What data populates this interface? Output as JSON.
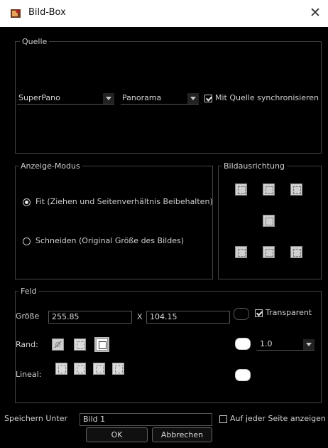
{
  "window": {
    "title": "Bild-Box",
    "close_glyph": "✕"
  },
  "quelle": {
    "legend": "Quelle",
    "source_select": "SuperPano",
    "type_select": "Panorama",
    "sync_label": "Mit Quelle synchronisieren",
    "sync_checked": true
  },
  "anzeige": {
    "legend": "Anzeige-Modus",
    "options": [
      {
        "label": "Fit (Ziehen und Seitenverhältnis Beibehalten)",
        "selected": true
      },
      {
        "label": "Schneiden (Original Größe des Bildes)",
        "selected": false
      }
    ]
  },
  "ausrichtung": {
    "legend": "Bildausrichtung"
  },
  "feld": {
    "legend": "Feld",
    "size_label": "Größe",
    "width_value": "255.85",
    "x_label": "X",
    "height_value": "104.15",
    "transparent_label": "Transparent",
    "transparent_checked": true,
    "border_label": "Rand:",
    "border_width_value": "1.0",
    "ruler_label": "Lineal:"
  },
  "save": {
    "label": "Speichern Unter",
    "value": "Bild 1",
    "every_page_label": "Auf jeder Seite anzeigen",
    "every_page_checked": false
  },
  "buttons": {
    "ok": "OK",
    "cancel": "Abbrechen"
  },
  "colors": {
    "swatch_white": "#ffffff",
    "swatch_none": "#000000"
  }
}
